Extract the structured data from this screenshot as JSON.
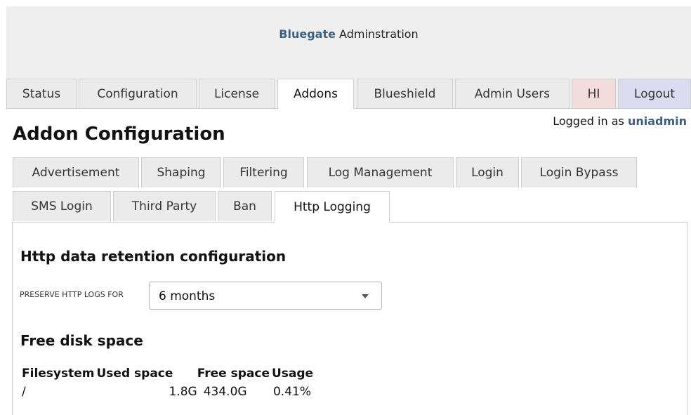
{
  "header": {
    "brand": "Bluegate",
    "title_rest": " Adminstration"
  },
  "main_tabs": {
    "status": "Status",
    "configuration": "Configuration",
    "license": "License",
    "addons": "Addons",
    "blueshield": "Blueshield",
    "admin_users": "Admin Users",
    "hi": "HI",
    "logout": "Logout"
  },
  "session": {
    "prefix": "Logged in as ",
    "user": "uniadmin"
  },
  "page": {
    "title": "Addon Configuration"
  },
  "sub_tabs": {
    "advertisement": "Advertisement",
    "shaping": "Shaping",
    "filtering": "Filtering",
    "log_management": "Log Management",
    "login": "Login",
    "login_bypass": "Login Bypass",
    "sms_login": "SMS Login",
    "third_party": "Third Party",
    "ban": "Ban",
    "http_logging": "Http Logging"
  },
  "retention": {
    "heading": "Http data retention configuration",
    "field_label": "Preserve HTTP logs for",
    "selected": "6 months"
  },
  "disk": {
    "heading": "Free disk space",
    "columns": [
      "Filesystem",
      "Used space",
      "Free space",
      "Usage"
    ],
    "rows": [
      {
        "filesystem": "/",
        "used": "1.8G",
        "free": "434.0G",
        "usage": "0.41%"
      }
    ]
  },
  "colors": {
    "brand": "#3d5f82",
    "hi_tab": "#f2dcdc",
    "logout_tab": "#dcdcf0"
  }
}
